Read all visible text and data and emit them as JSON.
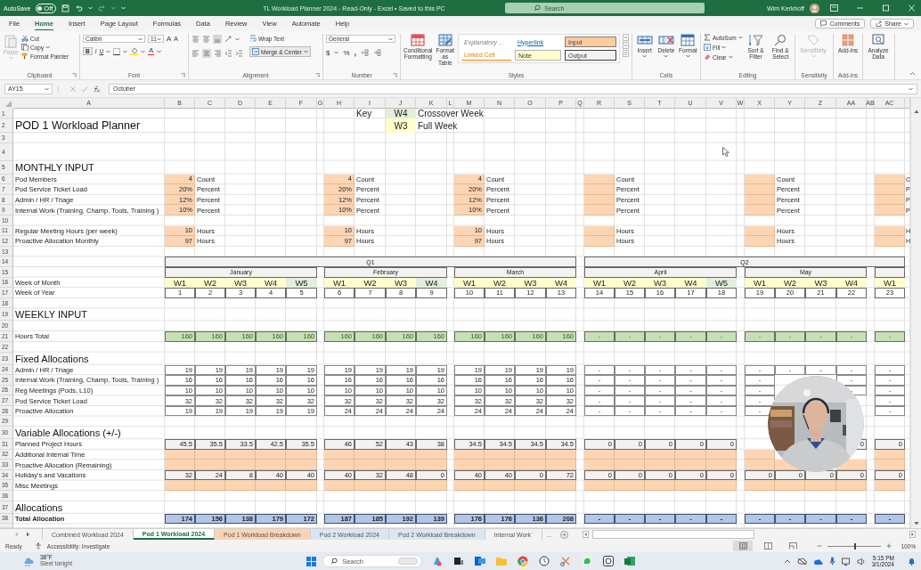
{
  "title_bar": {
    "autosave": {
      "label": "AutoSave",
      "on": false,
      "state_text": "Off"
    },
    "title": "TL Workload Planner 2024  -  Read-Only  -  Excel • Saved to this PC",
    "search": {
      "placeholder": "Search"
    },
    "user": "Wim Kerkhoff"
  },
  "menu_tabs": [
    {
      "label": "File",
      "selected": false
    },
    {
      "label": "Home",
      "selected": true
    },
    {
      "label": "Insert",
      "selected": false
    },
    {
      "label": "Page Layout",
      "selected": false
    },
    {
      "label": "Formulas",
      "selected": false
    },
    {
      "label": "Data",
      "selected": false
    },
    {
      "label": "Review",
      "selected": false
    },
    {
      "label": "View",
      "selected": false
    },
    {
      "label": "Automate",
      "selected": false
    },
    {
      "label": "Help",
      "selected": false
    }
  ],
  "ribbon_actions": [
    "Comments",
    "Share"
  ],
  "ribbon": {
    "groups": [
      {
        "label": "Clipboard",
        "buttons": [
          "Paste",
          "Cut",
          "Copy",
          "Format Painter"
        ]
      },
      {
        "label": "Font",
        "font": "Calibri",
        "size": "11",
        "buttons": [
          "A",
          "A",
          "B",
          "I",
          "U",
          "A"
        ]
      },
      {
        "label": "Alignment",
        "buttons": [
          "Wrap Text",
          "Merge & Center"
        ]
      },
      {
        "label": "Number",
        "format": "General",
        "buttons": [
          "$",
          "%",
          ","
        ]
      },
      {
        "label": "Styles",
        "buttons": [
          "Conditional Formatting",
          "Format as Table"
        ],
        "styles": [
          {
            "name": "Explanatory ...",
            "kind": "explanatory"
          },
          {
            "name": "Hyperlink",
            "kind": "hyperlink"
          },
          {
            "name": "Input",
            "kind": "input"
          },
          {
            "name": "Linked Cell",
            "kind": "linked"
          },
          {
            "name": "Note",
            "kind": "note"
          },
          {
            "name": "Output",
            "kind": "output"
          }
        ]
      },
      {
        "label": "Cells",
        "buttons": [
          "Insert",
          "Delete",
          "Format"
        ]
      },
      {
        "label": "Editing",
        "buttons": [
          "AutoSum",
          "Fill",
          "Clear",
          "Sort & Filter",
          "Find & Select"
        ]
      },
      {
        "label": "Sensitivity",
        "buttons": [
          "Sensitivity"
        ],
        "disabled": true
      },
      {
        "label": "Add-ins",
        "buttons": [
          "Add-ins"
        ]
      },
      {
        "buttons": [
          "Analyze Data"
        ]
      }
    ]
  },
  "formula_bar": {
    "name_box": "AY15",
    "value": "October"
  },
  "column_headers": [
    "A",
    "B",
    "C",
    "D",
    "E",
    "F",
    "G",
    "H",
    "I",
    "J",
    "K",
    "L",
    "M",
    "N",
    "O",
    "P",
    "Q",
    "R",
    "S",
    "T",
    "U",
    "V",
    "W",
    "X",
    "Y",
    "Z",
    "AA",
    "AB",
    "AC"
  ],
  "key": {
    "label": "Key",
    "items": [
      {
        "week": "W4",
        "crossover": true,
        "meaning": "Crossover Week"
      },
      {
        "week": "W3",
        "crossover": false,
        "meaning": "Full Week"
      }
    ]
  },
  "rows": [
    {
      "number": "1",
      "kind": "blank"
    },
    {
      "number": "2",
      "kind": "title",
      "label": "POD 1 Workload Planner"
    },
    {
      "number": "3",
      "kind": "blank"
    },
    {
      "number": "4",
      "kind": "blank"
    },
    {
      "number": "5",
      "kind": "section",
      "label": "MONTHLY INPUT"
    },
    {
      "number": "6",
      "kind": "monthly",
      "label": "Pod Members",
      "values": [
        "4",
        "4",
        "4"
      ],
      "units": [
        "Count",
        "Count",
        "Count",
        "Count",
        "Count",
        "C"
      ]
    },
    {
      "number": "7",
      "kind": "monthly",
      "label": "Pod Service Ticket Load",
      "values": [
        "20%",
        "20%",
        "20%"
      ],
      "units": [
        "Percent",
        "Percent",
        "Percent",
        "Percent",
        "Percent",
        "P"
      ]
    },
    {
      "number": "8",
      "kind": "monthly",
      "label": "Admin / HR / Triage",
      "values": [
        "12%",
        "12%",
        "12%"
      ],
      "units": [
        "Percent",
        "Percent",
        "Percent",
        "Percent",
        "Percent",
        "P"
      ]
    },
    {
      "number": "9",
      "kind": "monthly",
      "label": "Internal Work (Training, Champ, Tools,  Training )",
      "values": [
        "10%",
        "10%",
        "10%"
      ],
      "units": [
        "Percent",
        "Percent",
        "Percent",
        "Percent",
        "Percent",
        "P"
      ]
    },
    {
      "number": "10",
      "kind": "blank"
    },
    {
      "number": "11",
      "kind": "monthly",
      "label": "Regular Meeting Hours (per week)",
      "values": [
        "10",
        "10",
        "10"
      ],
      "units": [
        "Hours",
        "Hours",
        "Hours",
        "Hours",
        "Hours",
        "H"
      ]
    },
    {
      "number": "12",
      "kind": "monthly",
      "label": "Proactive Allocation Monthly",
      "values": [
        "97",
        "97",
        "97"
      ],
      "units": [
        "Hours",
        "Hours",
        "Hours",
        "Hours",
        "Hours",
        "H"
      ]
    },
    {
      "number": "13",
      "kind": "blank"
    },
    {
      "number": "14",
      "kind": "quarters",
      "values": [
        "Q1",
        "Q2"
      ]
    },
    {
      "number": "15",
      "kind": "months",
      "values": [
        "January",
        "February",
        "March",
        "April",
        "May"
      ]
    },
    {
      "number": "16",
      "kind": "weeks",
      "label": "Week of Month",
      "weeks": [
        {
          "text": "W1",
          "crossover": false
        },
        {
          "text": "W2",
          "crossover": false
        },
        {
          "text": "W3",
          "crossover": false
        },
        {
          "text": "W4",
          "crossover": false
        },
        {
          "text": "W5",
          "crossover": true
        },
        {
          "text": "W1",
          "crossover": false
        },
        {
          "text": "W2",
          "crossover": false
        },
        {
          "text": "W3",
          "crossover": false
        },
        {
          "text": "W4",
          "crossover": true
        },
        {
          "text": "W1",
          "crossover": false
        },
        {
          "text": "W2",
          "crossover": false
        },
        {
          "text": "W3",
          "crossover": false
        },
        {
          "text": "W4",
          "crossover": false
        },
        {
          "text": "W1",
          "crossover": false
        },
        {
          "text": "W2",
          "crossover": false
        },
        {
          "text": "W3",
          "crossover": false
        },
        {
          "text": "W4",
          "crossover": false
        },
        {
          "text": "W5",
          "crossover": true
        },
        {
          "text": "W1",
          "crossover": false
        },
        {
          "text": "W2",
          "crossover": false
        },
        {
          "text": "W3",
          "crossover": false
        },
        {
          "text": "W4",
          "crossover": false
        },
        {
          "text": "W1",
          "crossover": false
        }
      ]
    },
    {
      "number": "17",
      "kind": "week-numbers",
      "label": "Week of Year",
      "values": [
        "1",
        "2",
        "3",
        "4",
        "5",
        "6",
        "7",
        "8",
        "9",
        "10",
        "11",
        "12",
        "13",
        "14",
        "15",
        "16",
        "17",
        "18",
        "19",
        "20",
        "21",
        "22",
        "23"
      ]
    },
    {
      "number": "18",
      "kind": "blank"
    },
    {
      "number": "19",
      "kind": "section",
      "label": "WEEKLY INPUT"
    },
    {
      "number": "20",
      "kind": "blank"
    },
    {
      "number": "21",
      "kind": "hours",
      "label": "Hours Total",
      "values": [
        "160",
        "160",
        "160",
        "160",
        "160",
        "160",
        "160",
        "160",
        "160",
        "160",
        "160",
        "160",
        "160",
        "-",
        "-",
        "-",
        "-",
        "-",
        "-",
        "-",
        "-",
        "-",
        "-"
      ]
    },
    {
      "number": "22",
      "kind": "blank"
    },
    {
      "number": "23",
      "kind": "section",
      "label": "Fixed Allocations"
    },
    {
      "number": "24",
      "kind": "fixed",
      "label": "Admin / HR / Triage",
      "values": [
        "19",
        "19",
        "19",
        "19",
        "19",
        "19",
        "19",
        "19",
        "19",
        "19",
        "19",
        "19",
        "19",
        "-",
        "-",
        "-",
        "-",
        "-",
        "-",
        "-",
        "-",
        "-",
        "-"
      ]
    },
    {
      "number": "25",
      "kind": "fixed",
      "label": "Internal Work (Training, Champ, Tools,  Training )",
      "cells": {
        "B": "16",
        "C": "16",
        "D": "16",
        "E": "16",
        "F": "16",
        "H": "16",
        "I": "16",
        "J": "16",
        "K": "16",
        "M": "16",
        "N": "16",
        "O": "16",
        "P": "16",
        "R": "-",
        "S": "-",
        "T": "-",
        "U": "-",
        "V": "-",
        "X": "-",
        "AA": "-",
        "AC": "-"
      }
    },
    {
      "number": "26",
      "kind": "fixed",
      "label": "Reg Meetings (Pods,  L10)",
      "cells": {
        "B": "10",
        "C": "10",
        "D": "10",
        "E": "10",
        "F": "10",
        "H": "10",
        "I": "10",
        "J": "10",
        "K": "10",
        "M": "10",
        "N": "10",
        "O": "10",
        "P": "10",
        "R": "-",
        "S": "-",
        "T": "-",
        "U": "-",
        "V": "-",
        "X": "-",
        "AA": "-",
        "AC": "-"
      }
    },
    {
      "number": "27",
      "kind": "fixed",
      "label": "Pod Service Ticket Load",
      "cells": {
        "B": "32",
        "C": "32",
        "D": "32",
        "E": "32",
        "F": "32",
        "H": "32",
        "I": "32",
        "J": "32",
        "K": "32",
        "M": "32",
        "N": "32",
        "O": "32",
        "P": "32",
        "R": "-",
        "S": "-",
        "T": "-",
        "U": "-",
        "V": "-",
        "X": "-",
        "AC": "-"
      }
    },
    {
      "number": "28",
      "kind": "fixed",
      "label": "Proactive Allocation",
      "cells": {
        "B": "19",
        "C": "19",
        "D": "19",
        "E": "19",
        "F": "19",
        "H": "24",
        "I": "24",
        "J": "24",
        "K": "24",
        "M": "24",
        "N": "24",
        "O": "24",
        "P": "24",
        "R": "-",
        "S": "-",
        "T": "-",
        "U": "-",
        "V": "-",
        "X": "-",
        "AC": "-"
      }
    },
    {
      "number": "29",
      "kind": "blank"
    },
    {
      "number": "30",
      "kind": "section",
      "label": "Variable Allocations (+/-)"
    },
    {
      "number": "31",
      "kind": "variable",
      "label": "Planned Project Hours",
      "cells": {
        "B": "45.5",
        "C": "35.5",
        "D": "33.5",
        "E": "42.5",
        "F": "35.5",
        "H": "46",
        "I": "52",
        "J": "43",
        "K": "38",
        "M": "34.5",
        "N": "34.5",
        "O": "34.5",
        "P": "34.5",
        "R": "0",
        "S": "0",
        "T": "0",
        "U": "0",
        "V": "0",
        "AA": "0",
        "AC": "0"
      }
    },
    {
      "number": "32",
      "kind": "input-blank",
      "label": "Additional Internal Time"
    },
    {
      "number": "33",
      "kind": "input-blank",
      "label": "Proactive Allocation (Remaining)"
    },
    {
      "number": "34",
      "kind": "variable",
      "label": "Holiday's and Vacations",
      "values": [
        "32",
        "24",
        "8",
        "40",
        "40",
        "40",
        "32",
        "48",
        "0",
        "40",
        "40",
        "0",
        "72",
        "0",
        "0",
        "0",
        "0",
        "0",
        "0",
        "0",
        "0",
        "0",
        "0"
      ]
    },
    {
      "number": "35",
      "kind": "input-blank",
      "label": "Misc Meetings"
    },
    {
      "number": "36",
      "kind": "blank"
    },
    {
      "number": "37",
      "kind": "section",
      "label": "Allocations"
    },
    {
      "number": "38",
      "kind": "total",
      "label": "Total Allocation",
      "values": [
        "174",
        "156",
        "138",
        "179",
        "172",
        "187",
        "185",
        "192",
        "139",
        "176",
        "176",
        "136",
        "208",
        "-",
        "-",
        "-",
        "-",
        "-",
        "-",
        "-",
        "-",
        "-",
        "-"
      ]
    }
  ],
  "sheet_tabs": [
    {
      "label": "Combined Workload 2024",
      "selected": false
    },
    {
      "label": "Pod 1 Workload 2024",
      "selected": true
    },
    {
      "label": "Pod 1 Workload Breakdown",
      "selected": false,
      "color": "#fbd4b4"
    },
    {
      "label": "Pod 2 Workload 2024",
      "selected": false,
      "color": "#dce6f2"
    },
    {
      "label": "Pod 2 Workload Breakdown",
      "selected": false,
      "color": "#dce6f2"
    },
    {
      "label": "Internal Work`",
      "selected": false
    }
  ],
  "more_sheets": "...",
  "status_bar": {
    "mode": "Ready",
    "accessibility": "Accessibility: Investigate",
    "zoom": "100%",
    "zoom_slider": {
      "level": 0.5
    }
  },
  "taskbar": {
    "weather": {
      "temp": "38°F",
      "text": "Sleet tonight"
    },
    "search": {
      "placeholder": "Search"
    },
    "time": "5:15 PM",
    "date": "3/1/2024"
  }
}
